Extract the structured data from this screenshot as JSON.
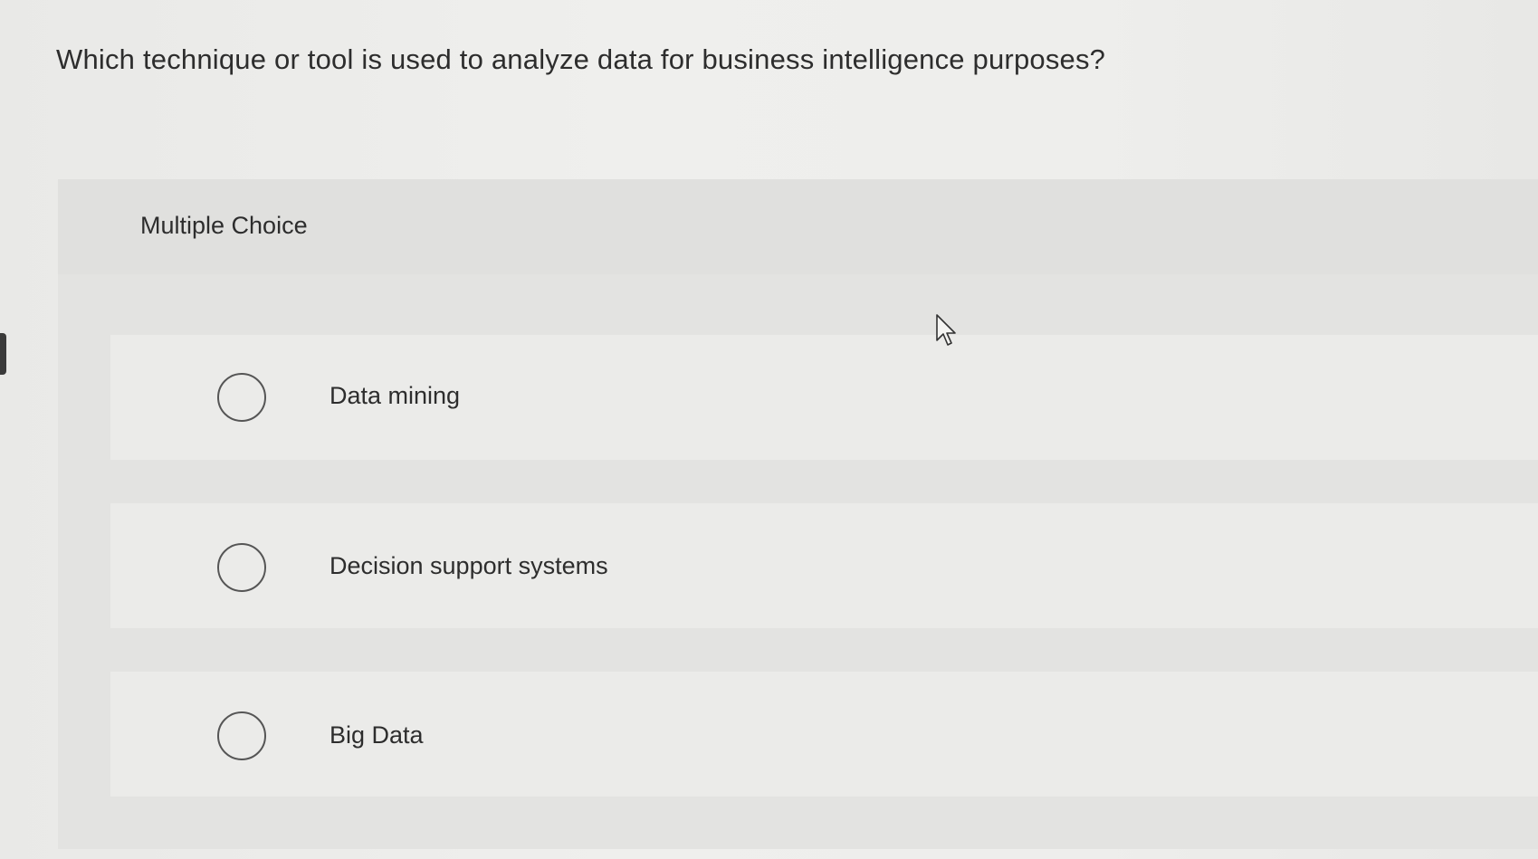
{
  "question": {
    "text": "Which technique or tool is used to analyze data for business intelligence purposes?"
  },
  "panel": {
    "title": "Multiple Choice",
    "options": [
      {
        "label": "Data mining",
        "selected": false
      },
      {
        "label": "Decision support systems",
        "selected": false
      },
      {
        "label": "Big Data",
        "selected": false
      }
    ]
  },
  "icons": {
    "cursor": "mouse-pointer-icon",
    "radio": "radio-button-icon"
  }
}
